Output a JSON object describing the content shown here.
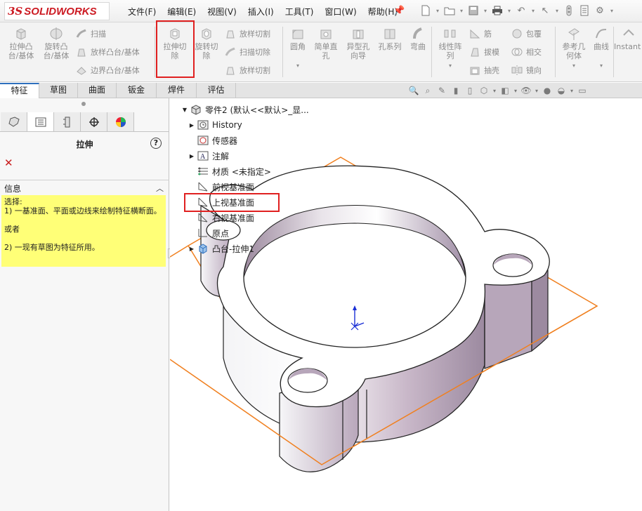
{
  "app": {
    "logo_prefix": "3S",
    "logo_name": "SOLIDWORKS"
  },
  "menubar": {
    "items": [
      "文件(F)",
      "编辑(E)",
      "视图(V)",
      "插入(I)",
      "工具(T)",
      "窗口(W)",
      "帮助(H)"
    ]
  },
  "command_manager": {
    "extrude_boss": "拉伸凸\n台/基体",
    "revolve_boss": "旋转凸\n台/基体",
    "sweep": "扫描",
    "loft_boss": "放样凸台/基体",
    "boundary_boss": "边界凸台/基体",
    "extrude_cut": "拉伸切\n除",
    "revolve_cut": "旋转切\n除",
    "loft_cut": "放样切割",
    "sweep_cut": "扫描切除",
    "boundary_cut": "放样切割",
    "fillet": "圆角",
    "simple_hole": "简单直\n孔",
    "hole_wizard": "异型孔\n向导",
    "hole_series": "孔系列",
    "flex": "弯曲",
    "linear_pattern": "线性阵\n列",
    "rib": "筋",
    "draft": "拔模",
    "shell": "抽壳",
    "wrap": "包覆",
    "intersect": "相交",
    "mirror": "镜向",
    "reference_geometry": "参考几\n何体",
    "curves": "曲线",
    "instant3d": "Instant"
  },
  "tabs": [
    "特征",
    "草图",
    "曲面",
    "钣金",
    "焊件",
    "评估"
  ],
  "active_tab_index": 0,
  "property_manager": {
    "title": "拉伸",
    "help": "?",
    "cancel": "✕",
    "info_title": "信息",
    "info_lines": [
      "选择:",
      "1) 一基准面、平面或边线来绘制特征横断面。",
      "",
      "或者",
      "",
      "2) 一现有草图为特征所用。"
    ]
  },
  "feature_tree": {
    "root": "零件2  (默认<<默认>_显...",
    "items": [
      {
        "label": "History",
        "expandable": true
      },
      {
        "label": "传感器",
        "expandable": false
      },
      {
        "label": "注解",
        "expandable": true
      },
      {
        "label": "材质 <未指定>",
        "expandable": false
      },
      {
        "label": "前视基准面",
        "expandable": false
      },
      {
        "label": "上视基准面",
        "expandable": false
      },
      {
        "label": "右视基准面",
        "expandable": false
      },
      {
        "label": "原点",
        "expandable": false
      },
      {
        "label": "凸台-拉伸1",
        "expandable": true
      }
    ],
    "selected_item": "上视基准面"
  },
  "colors": {
    "accent_blue": "#2e6fbd",
    "highlight_red": "#e02020",
    "plane_orange": "#f08020",
    "info_yellow": "#ffff77",
    "logo_red": "#cc1a22"
  }
}
